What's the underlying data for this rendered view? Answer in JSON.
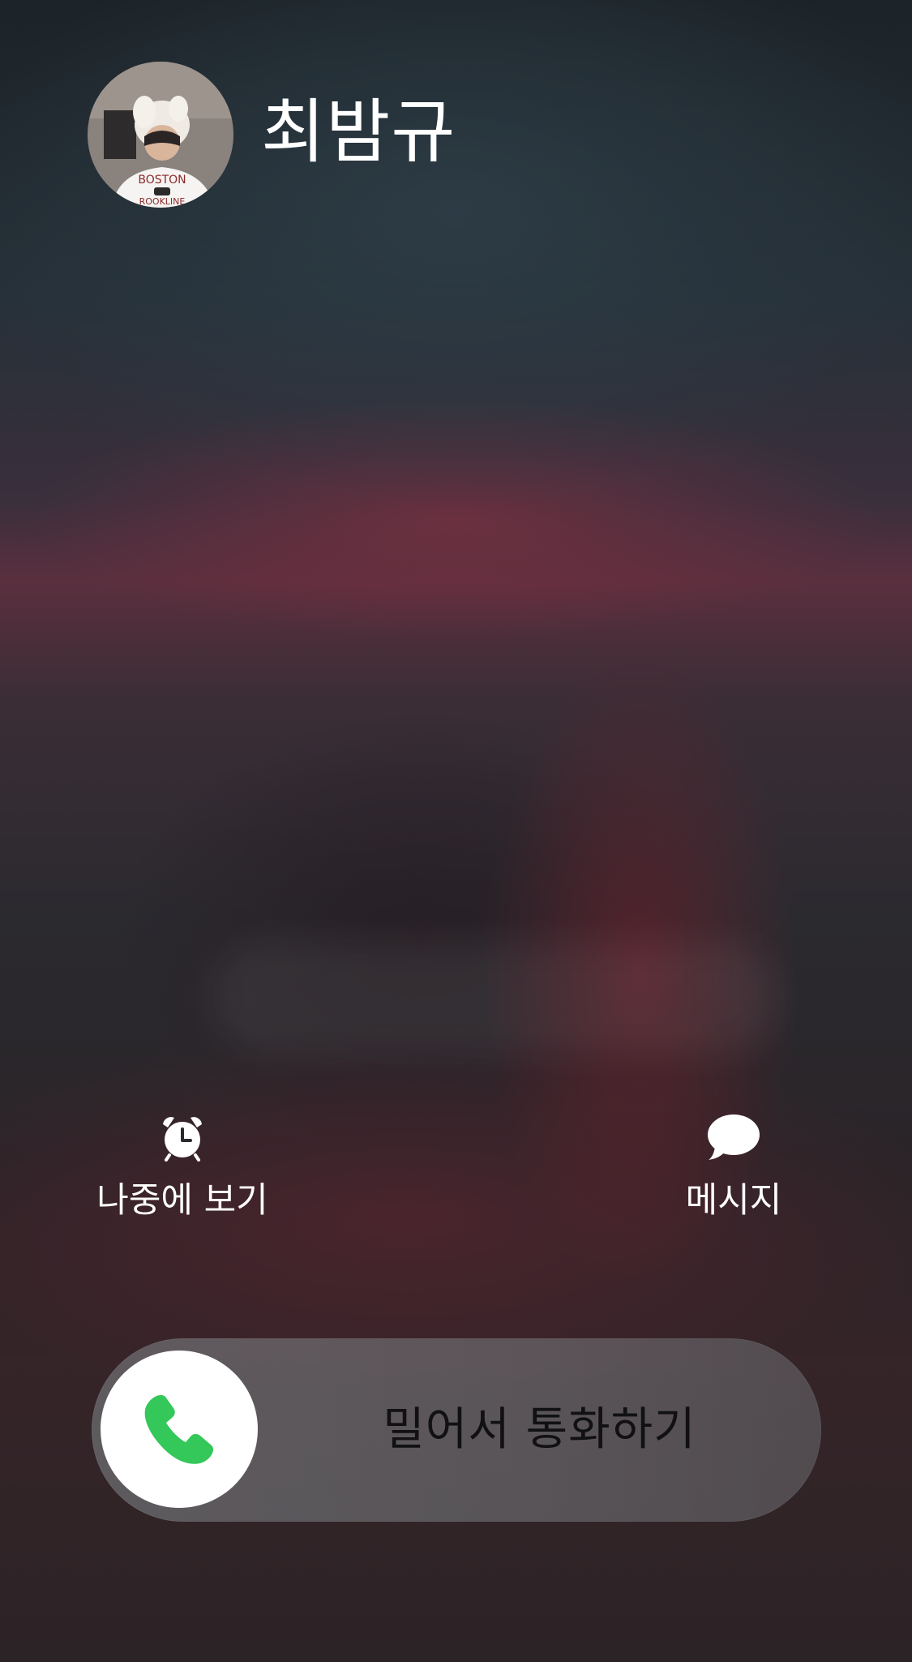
{
  "caller": {
    "name": "최밤규",
    "avatar_icon": "contact-photo"
  },
  "actions": {
    "remind_later": {
      "label": "나중에 보기",
      "icon": "alarm-clock-icon"
    },
    "message": {
      "label": "메시지",
      "icon": "speech-bubble-icon"
    }
  },
  "slider": {
    "label": "밀어서 통화하기",
    "icon": "phone-icon",
    "icon_color": "#34c759"
  }
}
